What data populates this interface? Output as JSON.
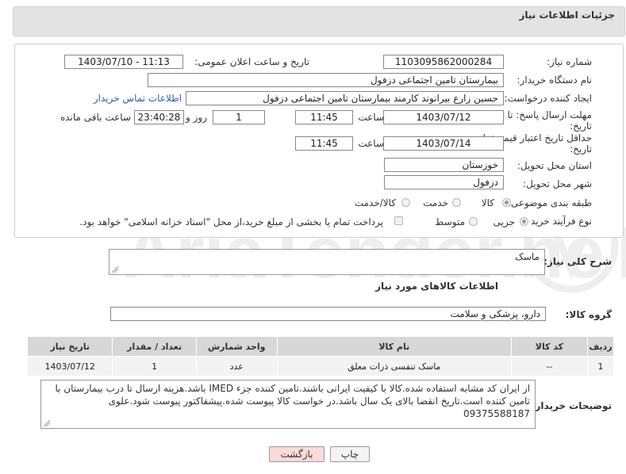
{
  "header": {
    "title": "جزئیات اطلاعات نیاز"
  },
  "form": {
    "need_number_label": "شماره نیاز:",
    "need_number": "1103095862000284",
    "announce_label": "تاریخ و ساعت اعلان عمومی:",
    "announce_value": "1403/07/10 - 11:13",
    "buyer_org_label": "نام دستگاه خریدار:",
    "buyer_org": "بیمارستان تامین اجتماعی دزفول",
    "requester_label": "ایجاد کننده درخواست:",
    "requester": "حسین زارع بیرانوند کارمند بیمارستان تامین اجتماعی دزفول",
    "contact_link": "اطلاعات تماس خریدار",
    "deadline_label_1": "مهلت ارسال پاسخ: تا",
    "deadline_label_2": "تاریخ:",
    "deadline_date": "1403/07/12",
    "time_label": "ساعت",
    "deadline_time": "11:45",
    "days": "1",
    "days_label": "روز و",
    "remaining": "23:40:28",
    "remaining_label": "ساعت باقی مانده",
    "validity_label_1": "حداقل تاریخ اعتبار قیمت: تا",
    "validity_label_2": "تاریخ:",
    "validity_date": "1403/07/14",
    "validity_time": "11:45",
    "province_label": "استان محل تحویل:",
    "province": "خوزستان",
    "city_label": "شهر محل تحویل:",
    "city": "دزفول",
    "category_label": "طبقه بندی موضوعی:",
    "category_options": [
      "کالا",
      "خدمت",
      "کالا/خدمت"
    ],
    "category_selected": "کالا",
    "process_label": "نوع فرآیند خرید :",
    "process_options": [
      "جزیی",
      "متوسط"
    ],
    "process_selected": "جزیی",
    "payment_note": "پرداخت تمام یا بخشی از مبلغ خرید،از محل \"اسناد خزانه اسلامی\" خواهد بود."
  },
  "description": {
    "label": "شرح کلی نیاز:",
    "value": "ماسک"
  },
  "goods": {
    "section_title": "اطلاعات کالاهای مورد نیاز",
    "group_label": "گروه کالا:",
    "group_value": "دارو، پزشکی و سلامت",
    "columns": [
      "ردیف",
      "کد کالا",
      "نام کالا",
      "واحد شمارش",
      "تعداد / مقدار",
      "تاریخ نیاز"
    ],
    "rows": [
      [
        "1",
        "--",
        "ماسک تنفسی ذرات معلق",
        "عدد",
        "1",
        "1403/07/12"
      ]
    ]
  },
  "buyer_notes": {
    "label": "توضیحات خریدار:",
    "value": "از ایران کد مشابه استفاده شده.کالا با کیفیت ایرانی باشند.تامین کننده جزء IMED باشد.هزینه ارسال تا درب بیمارستان با تامین کننده است.تاریخ انقضا بالای یک سال باشد.در خواست کالا پیوست شده.پیشفاکتور پیوست شود.علوی 09375588187"
  },
  "buttons": {
    "print": "چاپ",
    "back": "بازگشت"
  },
  "colors": {
    "link": "#2f5fa8",
    "header_bg": "#e3e3e3",
    "back_bg": "#fbdada"
  }
}
